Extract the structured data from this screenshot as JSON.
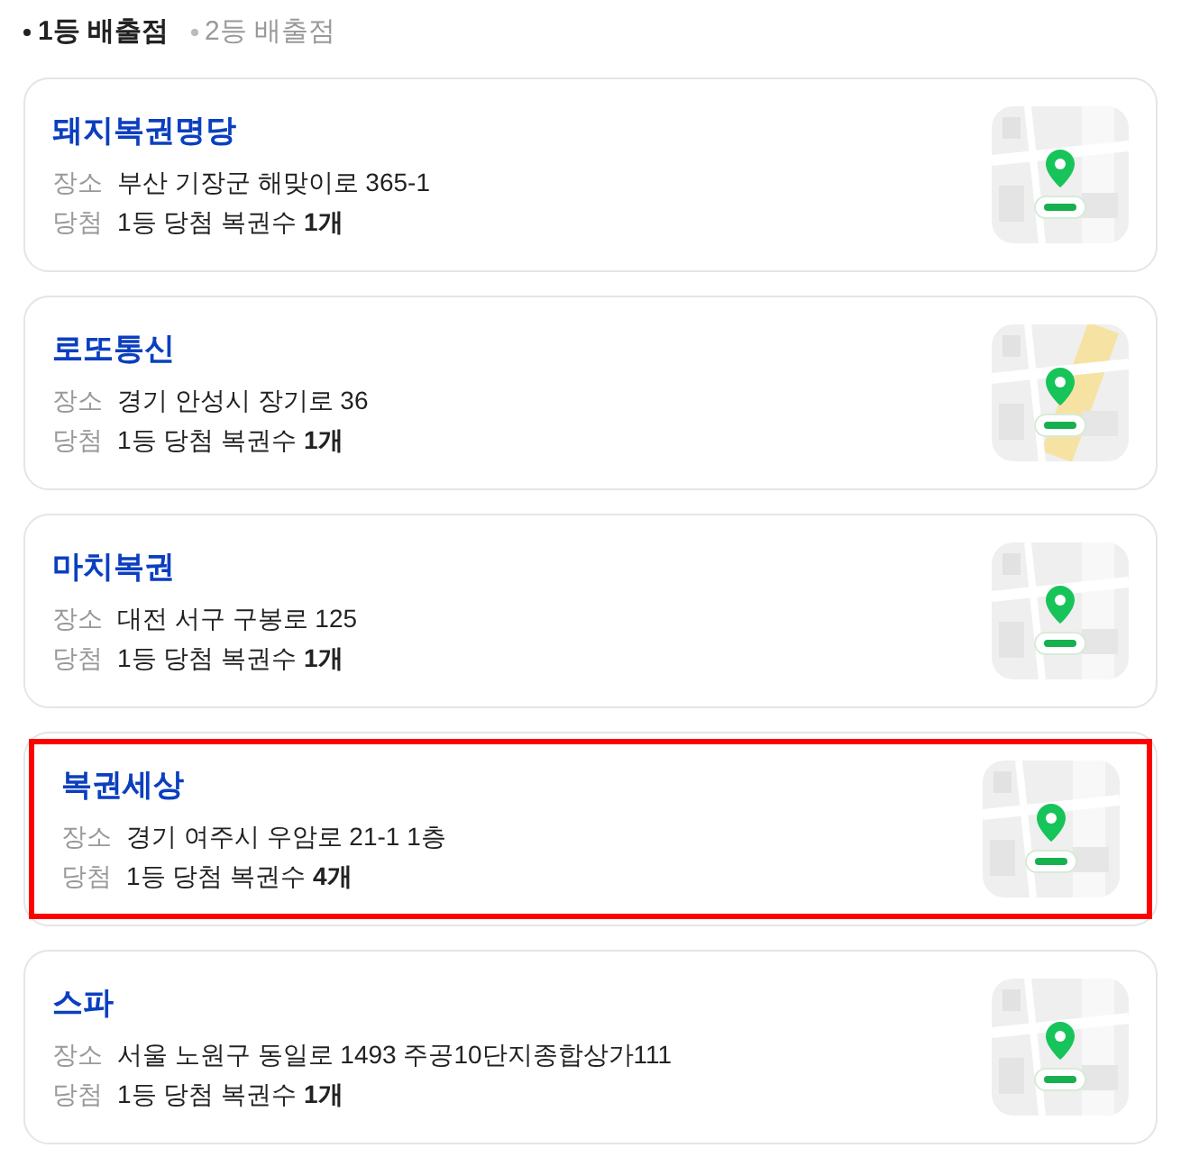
{
  "tabs": [
    {
      "label": "1등 배출점",
      "selected": true
    },
    {
      "label": "2등 배출점",
      "selected": false
    }
  ],
  "stores": [
    {
      "name": "돼지복권명당",
      "place_label": "장소",
      "address": "부산 기장군 해맞이로 365-1",
      "win_label": "당첨",
      "win_text": "1등 당첨 복권수 **1개**",
      "highlighted": false
    },
    {
      "name": "로또통신",
      "place_label": "장소",
      "address": "경기 안성시 장기로 36",
      "win_label": "당첨",
      "win_text": "1등 당첨 복권수 **1개**",
      "highlighted": false
    },
    {
      "name": "마치복권",
      "place_label": "장소",
      "address": "대전 서구 구봉로 125",
      "win_label": "당첨",
      "win_text": "1등 당첨 복권수 **1개**",
      "highlighted": false
    },
    {
      "name": "복권세상",
      "place_label": "장소",
      "address": "경기 여주시 우암로 21-1 1층",
      "win_label": "당첨",
      "win_text": "1등 당첨 복권수 **4개**",
      "highlighted": true
    },
    {
      "name": "스파",
      "place_label": "장소",
      "address": "서울 노원구 동일로 1493 주공10단지종합상가111",
      "win_label": "당첨",
      "win_text": "1등 당첨 복권수 **1개**",
      "highlighted": false
    }
  ]
}
